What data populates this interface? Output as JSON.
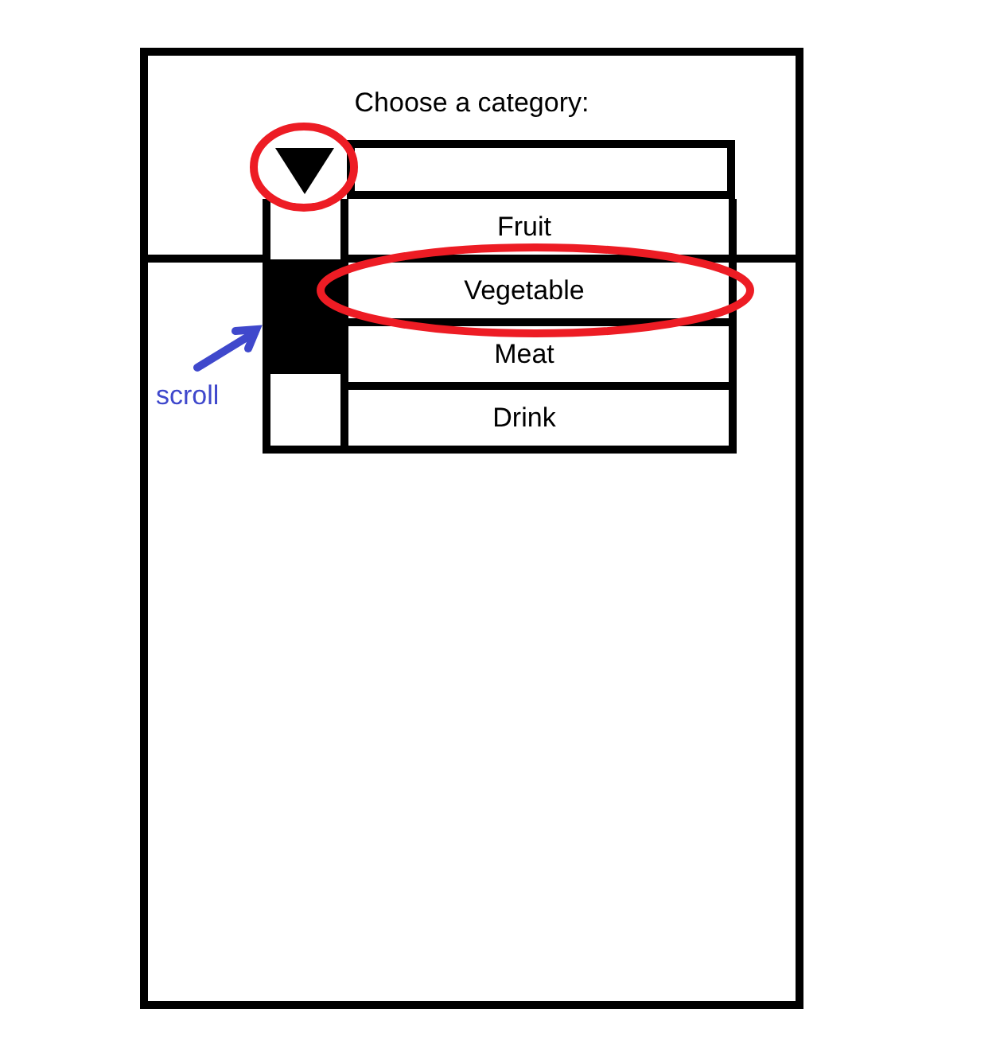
{
  "prompt": "Choose a category:",
  "dropdown": {
    "arrow_circled": true,
    "expanded": true,
    "options": [
      {
        "label": "Fruit",
        "selected": false
      },
      {
        "label": "Vegetable",
        "selected": true
      },
      {
        "label": "Meat",
        "selected": false
      },
      {
        "label": "Drink",
        "selected": false
      }
    ]
  },
  "annotation": {
    "label": "scroll"
  }
}
